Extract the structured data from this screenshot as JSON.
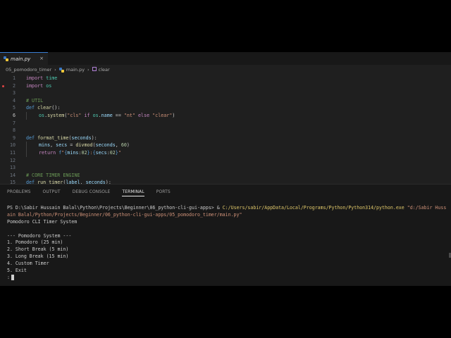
{
  "editor": {
    "tab": {
      "label": "main.py",
      "close": "×"
    },
    "breadcrumb": {
      "folder": "05_pomodoro_timer",
      "file": "main.py",
      "symbol": "clear",
      "sep": "›"
    },
    "lines": [
      {
        "n": "1",
        "text": "import time"
      },
      {
        "n": "2",
        "text": "import os",
        "breakpoint": true
      },
      {
        "n": "3",
        "text": ""
      },
      {
        "n": "4",
        "text": "# UTIL"
      },
      {
        "n": "5",
        "text": "def clear():"
      },
      {
        "n": "6",
        "text": "    os.system(\"cls\" if os.name == \"nt\" else \"clear\")"
      },
      {
        "n": "7",
        "text": ""
      },
      {
        "n": "8",
        "text": ""
      },
      {
        "n": "9",
        "text": "def format_time(seconds):"
      },
      {
        "n": "10",
        "text": "    mins, secs = divmod(seconds, 60)"
      },
      {
        "n": "11",
        "text": "    return f\"{mins:02}:{secs:02}\""
      },
      {
        "n": "12",
        "text": ""
      },
      {
        "n": "13",
        "text": ""
      },
      {
        "n": "14",
        "text": "# CORE TIMER ENGINE"
      },
      {
        "n": "15",
        "text": "def run_timer(label, seconds):"
      }
    ]
  },
  "panel": {
    "tabs": [
      "PROBLEMS",
      "OUTPUT",
      "DEBUG CONSOLE",
      "TERMINAL",
      "PORTS"
    ],
    "active_tab": "TERMINAL"
  },
  "terminal": {
    "prompt": "PS D:\\Sabir Hussain Balal\\Python\\Projects\\Beginner\\06_python-cli-gui-apps> ",
    "amp": "& ",
    "exe": "C:/Users/sabir/AppData/Local/Programs/Python/Python314/python.exe",
    "script_part1": "\"d:/Sabir Huss",
    "script_part2": "ain Balal/Python/Projects/Beginner/06_python-cli-gui-apps/05_pomodoro_timer/main.py\"",
    "output": [
      "Pomodoro CLI Timer System",
      "",
      "--- Pomodoro System ---",
      "1. Pomodoro (25 min)",
      "2. Short Break (5 min)",
      "3. Long Break (15 min)",
      "4. Custom Timer",
      "5. Exit"
    ],
    "input_prompt": ":"
  },
  "colors": {
    "editor_bg": "#1f1f1f",
    "panel_bg": "#181818",
    "keyword": "#569cd6",
    "string": "#ce9178",
    "comment": "#6a9955",
    "function": "#dcdcaa",
    "breakpoint": "#e04444"
  }
}
